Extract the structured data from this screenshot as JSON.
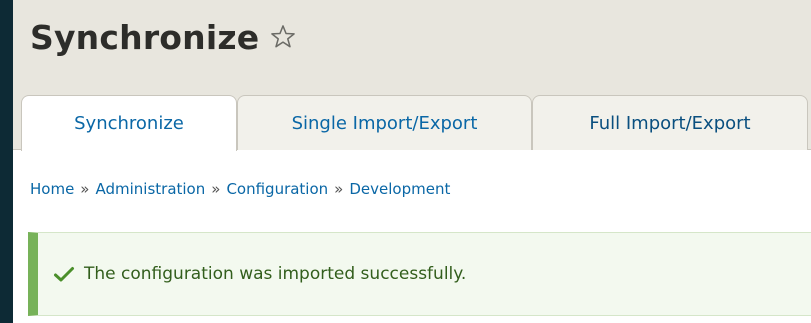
{
  "header": {
    "title": "Synchronize",
    "star_icon": "star-outline-icon"
  },
  "tabs": [
    {
      "label": "Synchronize",
      "active": true
    },
    {
      "label": "Single Import/Export",
      "active": false
    },
    {
      "label": "Full Import/Export",
      "active": false
    }
  ],
  "breadcrumb": {
    "items": [
      "Home",
      "Administration",
      "Configuration",
      "Development"
    ],
    "separator": "»"
  },
  "message": {
    "type": "status",
    "text": "The configuration was imported successfully.",
    "icon": "checkmark-icon"
  },
  "colors": {
    "background": "#0d2a35",
    "header_bg": "#e8e6de",
    "link": "#0a67a6",
    "success_border": "#77b259",
    "success_bg": "#f3f9ef",
    "success_text": "#325e1c"
  }
}
